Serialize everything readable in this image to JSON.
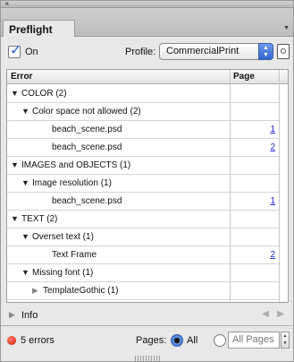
{
  "window": {
    "close_glyph": "×"
  },
  "tabs": [
    {
      "label": "Preflight"
    }
  ],
  "toolbar": {
    "on_checkbox": {
      "label": "On",
      "checked": true,
      "checkmark": "✓"
    },
    "profile": {
      "label": "Profile:",
      "value": "CommercialPrint"
    }
  },
  "list": {
    "columns": {
      "error": "Error",
      "page": "Page"
    },
    "rows": [
      {
        "indent": 0,
        "expander": "▼",
        "label": "COLOR (2)",
        "page": ""
      },
      {
        "indent": 1,
        "expander": "▼",
        "label": "Color space not allowed (2)",
        "page": ""
      },
      {
        "indent": 2,
        "expander": "",
        "label": "beach_scene.psd",
        "page": "1"
      },
      {
        "indent": 2,
        "expander": "",
        "label": "beach_scene.psd",
        "page": "2"
      },
      {
        "indent": 0,
        "expander": "▼",
        "label": "IMAGES and OBJECTS (1)",
        "page": ""
      },
      {
        "indent": 1,
        "expander": "▼",
        "label": "Image resolution (1)",
        "page": ""
      },
      {
        "indent": 2,
        "expander": "",
        "label": "beach_scene.psd",
        "page": "1"
      },
      {
        "indent": 0,
        "expander": "▼",
        "label": "TEXT (2)",
        "page": ""
      },
      {
        "indent": 1,
        "expander": "▼",
        "label": "Overset text (1)",
        "page": ""
      },
      {
        "indent": 2,
        "expander": "",
        "label": "Text Frame",
        "page": "2"
      },
      {
        "indent": 1,
        "expander": "▼",
        "label": "Missing font (1)",
        "page": ""
      },
      {
        "indent": 2,
        "expander": "▶",
        "label": "TemplateGothic (1)",
        "page": ""
      }
    ]
  },
  "info": {
    "label": "Info",
    "expander": "▶",
    "prev": "◀",
    "next": "▶"
  },
  "status": {
    "errors": "5 errors",
    "pages_label": "Pages:",
    "all_label": "All",
    "pages_placeholder": "All Pages",
    "selected_pages_option": "All",
    "error_color": "#d0180a"
  },
  "icons": {
    "checkbox": "checkmark-icon",
    "profile_stepper": "up-down-stepper-icon",
    "profile_doc": "document-magnifier-icon",
    "status_dot": "red-error-dot-icon"
  },
  "colors": {
    "accent": "#2f66d0",
    "link": "#2323d8",
    "panel_bg": "#e8e8e8"
  }
}
